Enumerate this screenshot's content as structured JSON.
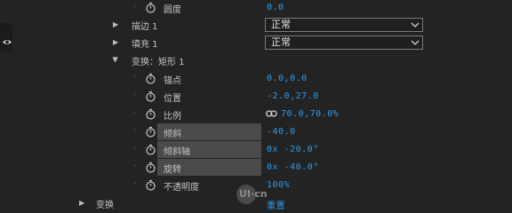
{
  "rows": {
    "roundness": {
      "label": "圆度",
      "value": "0.0"
    },
    "stroke": {
      "label": "描边 1",
      "mode": "正常"
    },
    "fill": {
      "label": "填充 1",
      "mode": "正常"
    },
    "transform_rect": {
      "label": "变换：矩形 1"
    },
    "anchor": {
      "label": "锚点",
      "value": "0.0,0.0"
    },
    "position": {
      "label": "位置",
      "value": "-2.0,27.0"
    },
    "scale": {
      "label": "比例",
      "value": "70.0,70.0%"
    },
    "skew": {
      "label": "倾斜",
      "value": "-40.0"
    },
    "skew_axis": {
      "label": "倾斜轴",
      "value": "0x -20.0°"
    },
    "rotation": {
      "label": "旋转",
      "value": "0x -40.0°"
    },
    "opacity": {
      "label": "不透明度",
      "value": "100%"
    },
    "transform": {
      "label": "变换",
      "reset": "重置"
    }
  },
  "watermark": "UI·cn",
  "colors": {
    "value": "#2e9bea",
    "background": "#232323",
    "highlight": "#4a4a4a"
  }
}
